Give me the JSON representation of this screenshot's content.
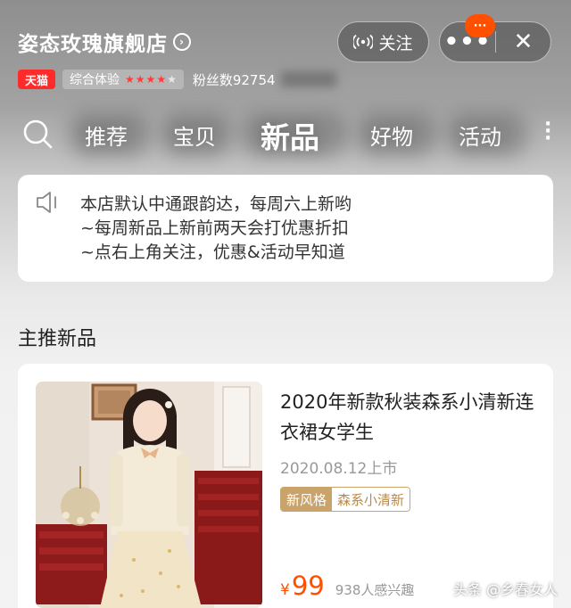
{
  "header": {
    "store_name": "姿态玫瑰旗舰店",
    "tmall_label": "天猫",
    "experience_label": "综合体验",
    "rating_stars": 4,
    "rating_max": 5,
    "fans_label": "粉丝数92754",
    "follow_label": "关注",
    "notification_badge": "···",
    "more_icon": "more-dots-icon",
    "close_icon": "close-icon"
  },
  "tabs": {
    "items": [
      {
        "label": "推荐"
      },
      {
        "label": "宝贝"
      },
      {
        "label": "新品"
      },
      {
        "label": "好物"
      },
      {
        "label": "活动"
      }
    ],
    "active_index": 2
  },
  "notice": {
    "lines": [
      "本店默认中通跟韵达，每周六上新哟",
      "~每周新品上新前两天会打优惠折扣",
      "~点右上角关注，优惠&活动早知道"
    ]
  },
  "section": {
    "title": "主推新品"
  },
  "product": {
    "title": "2020年新款秋装森系小清新连衣裙女学生",
    "launch_date": "2020.08.12上市",
    "tag_primary": "新风格",
    "tag_secondary": "森系小清新",
    "price_symbol": "¥",
    "price": "99",
    "interest": "938人感兴趣"
  },
  "watermark": "头条 @乡春女人",
  "colors": {
    "accent": "#ff5000",
    "tmall_red": "#ff2a2a",
    "tag_gold": "#c9a36a"
  }
}
